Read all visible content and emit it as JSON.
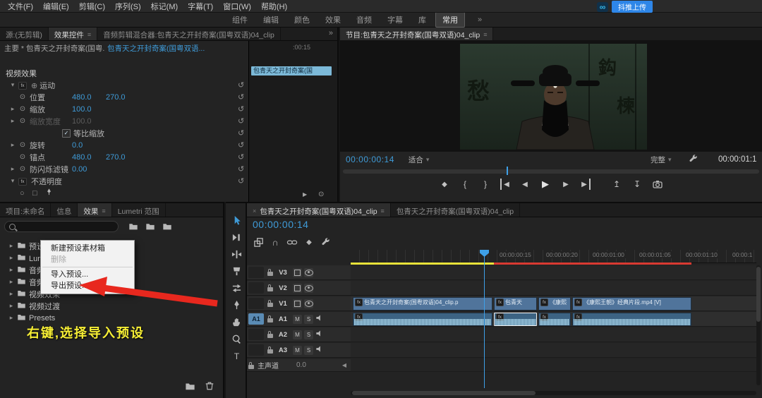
{
  "glyphs": {
    "infinity": "∞",
    "overflow": "»",
    "panel_menu": "≡",
    "close": "×",
    "chev_right": "▸",
    "chev_down": "▾",
    "reset": "↺",
    "stopwatch": "⊙",
    "check": "✓",
    "fx": "fx",
    "magnet": "∩",
    "marker": "◆",
    "brace_in": "{",
    "brace_out": "}",
    "tri_right": "▶",
    "tri_left": "◀",
    "lift": "↥",
    "extract": "↧",
    "motion": "⊕",
    "circle": "○",
    "square": "□"
  },
  "menubar": {
    "items": [
      "文件(F)",
      "编辑(E)",
      "剪辑(C)",
      "序列(S)",
      "标记(M)",
      "字幕(T)",
      "窗口(W)",
      "帮助(H)"
    ],
    "upload_label": "抖推上传"
  },
  "workspaces": {
    "items": [
      "组件",
      "编辑",
      "颜色",
      "效果",
      "音频",
      "字幕",
      "库",
      "常用"
    ]
  },
  "effect_controls": {
    "tab_source": "源:(无剪辑)",
    "tab_effect_controls": "效果控件",
    "tab_audio_mixer": "音频剪辑混合器:包青天之开封奇案(国粤双语)04_clip",
    "master_clip": "主要 * 包青天之开封奇案(国粤...",
    "sequence_clip": "包青天之开封奇案(国粤双语...",
    "ruler_time": ":00:15",
    "video_effects_header": "视频效果",
    "motion_group": "运动",
    "opacity_group": "不透明度",
    "rows": [
      {
        "name": "位置",
        "v1": "480.0",
        "v2": "270.0"
      },
      {
        "name": "缩放",
        "v1": "100.0"
      },
      {
        "name": "缩放宽度",
        "v1": "100.0"
      },
      {
        "name": "等比缩放"
      },
      {
        "name": "旋转",
        "v1": "0.0"
      },
      {
        "name": "锚点",
        "v1": "480.0",
        "v2": "270.0"
      },
      {
        "name": "防闪烁滤镜",
        "v1": "0.00"
      }
    ],
    "lane_clip_label": "包青天之开封奇案(国"
  },
  "program": {
    "tab": "节目:包青天之开封奇案(国粤双语)04_clip",
    "timecode": "00:00:00:14",
    "zoom_level": "适合",
    "playback_resolution": "完整",
    "duration": "00:00:01:1",
    "board_glyphs": [
      "愁",
      "鈎",
      "楝"
    ]
  },
  "project": {
    "tab_project": "项目:未命名",
    "tab_info": "信息",
    "tab_effects": "效果",
    "tab_lumetri": "Lumetri 范围",
    "tree": [
      "预设",
      "Lumetri 预设",
      "音频效果",
      "音频过渡",
      "视频效果",
      "视频过渡",
      "Presets"
    ]
  },
  "context_menu": {
    "new_bin": "新建预设素材箱",
    "delete": "删除",
    "import": "导入预设...",
    "export": "导出预设..."
  },
  "annotation": "右键,选择导入预设",
  "timeline": {
    "tab_active": "包青天之开封奇案(国粤双语)04_clip",
    "tab_inactive": "包青天之开封奇案(国粤双语)04_clip",
    "timecode": "00:00:00:14",
    "ruler_labels": [
      "00:00:00:15",
      "00:00:00:20",
      "00:00:01:00",
      "00:00:01:05",
      "00:00:01:10",
      "00:00:1"
    ],
    "tracks": {
      "v3": "V3",
      "v2": "V2",
      "v1": "V1",
      "a1": "A1",
      "a2": "A2",
      "a3": "A3",
      "a1_patch": "A1",
      "master": "主声道",
      "master_value": "0.0",
      "mute": "M",
      "solo": "S"
    },
    "clips": {
      "v1_1": "包青天之开封奇案(国粤双语)04_clip.p",
      "v1_2": "包青天",
      "v1_3": "《康熙",
      "v1_4": "《康熙王朝》经典片段.mp4 [V]"
    }
  },
  "colors": {
    "accent": "#2d8ceb",
    "timecode_blue": "#3f9bd8",
    "render_yellow": "#e8e23a",
    "render_red": "#d83a32",
    "annotation_yellow": "#f7ef35",
    "arrow_red": "#e8281e"
  }
}
